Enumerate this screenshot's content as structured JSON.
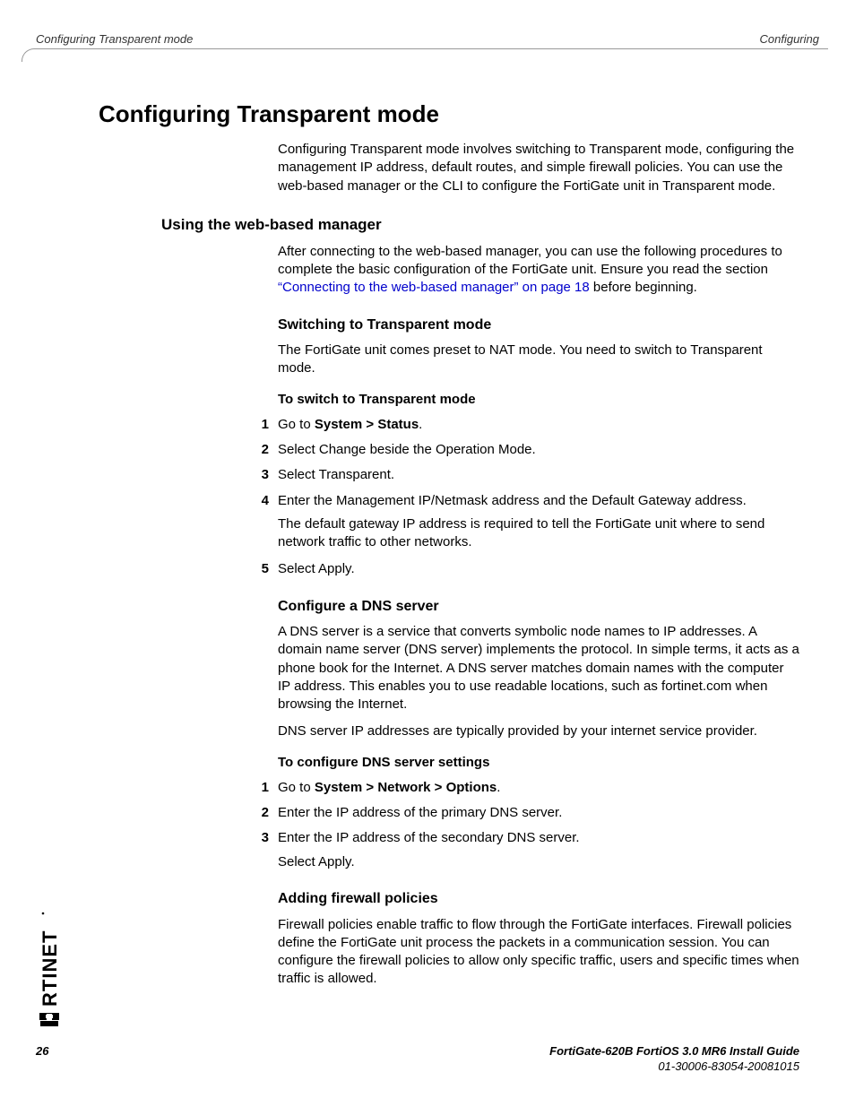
{
  "header": {
    "left": "Configuring Transparent mode",
    "right": "Configuring"
  },
  "main": {
    "h1": "Configuring Transparent mode",
    "intro": "Configuring Transparent mode involves switching to Transparent mode, configuring the management IP address, default routes, and simple firewall policies. You can use the web-based manager or the CLI to configure the FortiGate unit in Transparent mode.",
    "h2_web": "Using the web-based manager",
    "web_intro_before": "After connecting to the web-based manager, you can use the following procedures to complete the basic configuration of the FortiGate unit. Ensure you read the section ",
    "web_intro_link": "“Connecting to the web-based manager” on page 18",
    "web_intro_after": " before beginning.",
    "h3_switch": "Switching to Transparent mode",
    "switch_intro": "The FortiGate unit comes preset to NAT mode. You need to switch to Transparent mode.",
    "switch_proc_title": "To switch to Transparent mode",
    "switch_steps": [
      {
        "pre": "Go to ",
        "bold": "System > Status",
        "post": "."
      },
      {
        "text": "Select Change beside the Operation Mode."
      },
      {
        "text": "Select Transparent."
      },
      {
        "text": "Enter the Management IP/Netmask address and the Default Gateway address.",
        "extra": "The default gateway IP address is required to tell the FortiGate unit where to send network traffic to other networks."
      },
      {
        "text": "Select Apply."
      }
    ],
    "h3_dns": "Configure a DNS server",
    "dns_p1": "A DNS server is a service that converts symbolic node names to IP addresses. A domain name server (DNS server) implements the protocol. In simple terms, it acts as a phone book for the Internet. A DNS server matches domain names with the computer IP address. This enables you to use readable locations, such as fortinet.com when browsing the Internet.",
    "dns_p2": "DNS server IP addresses are typically provided by your internet service provider.",
    "dns_proc_title": "To configure DNS server settings",
    "dns_steps": [
      {
        "pre": "Go to ",
        "bold": "System > Network > Options",
        "post": "."
      },
      {
        "text": "Enter the IP address of the primary DNS server."
      },
      {
        "text": "Enter the IP address of the secondary DNS server.",
        "extra": "Select Apply."
      }
    ],
    "h3_fw": "Adding firewall policies",
    "fw_p1": "Firewall policies enable traffic to flow through the FortiGate interfaces. Firewall policies define the FortiGate unit process the packets in a communication session. You can configure the firewall policies to allow only specific traffic, users and specific times when traffic is allowed."
  },
  "footer": {
    "page": "26",
    "title": "FortiGate-620B FortiOS 3.0 MR6 Install Guide",
    "docid": "01-30006-83054-20081015"
  }
}
